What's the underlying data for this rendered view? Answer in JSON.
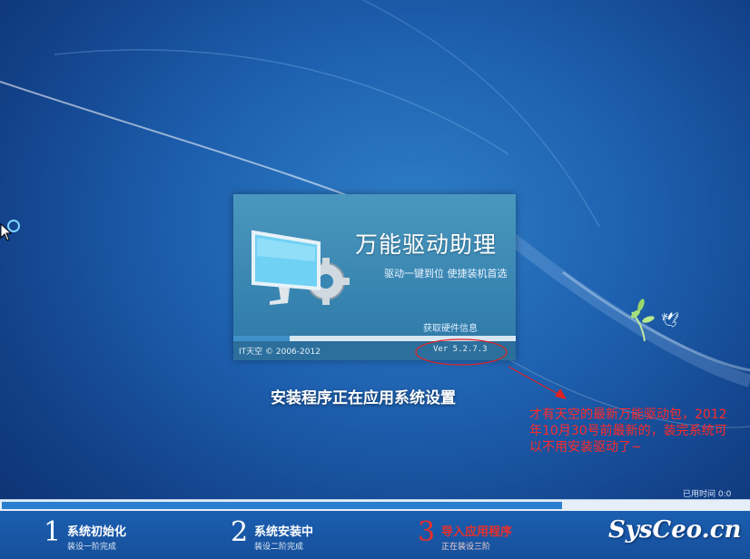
{
  "splash": {
    "product_name": "万能驱动助理",
    "tagline": "驱动一键到位 使捷装机首选",
    "status": "获取硬件信息",
    "copyright": "IT天空 © 2006-2012",
    "version": "Ver 5.2.7.3",
    "progress_fraction": 0.2
  },
  "headline": "安装程序正在应用系统设置",
  "annotation": "才有天空的最新万能驱动包，2012年10月30号前最新的，装完系统可以不用安装驱动了~",
  "time_note": "已用时间 0:0",
  "overall_progress_fraction": 0.75,
  "steps": [
    {
      "number": "1",
      "title": "系统初始化",
      "subtitle": "装设一阶完成"
    },
    {
      "number": "2",
      "title": "系统安装中",
      "subtitle": "装设二阶完成"
    },
    {
      "number": "3",
      "title": "导入应用程序",
      "subtitle": "正在装设三阶"
    }
  ],
  "watermark": "SysCeo.cn",
  "colors": {
    "active_step": "#e8302a",
    "annotation": "#ff2a2a",
    "progress": "#2a7fd0"
  }
}
